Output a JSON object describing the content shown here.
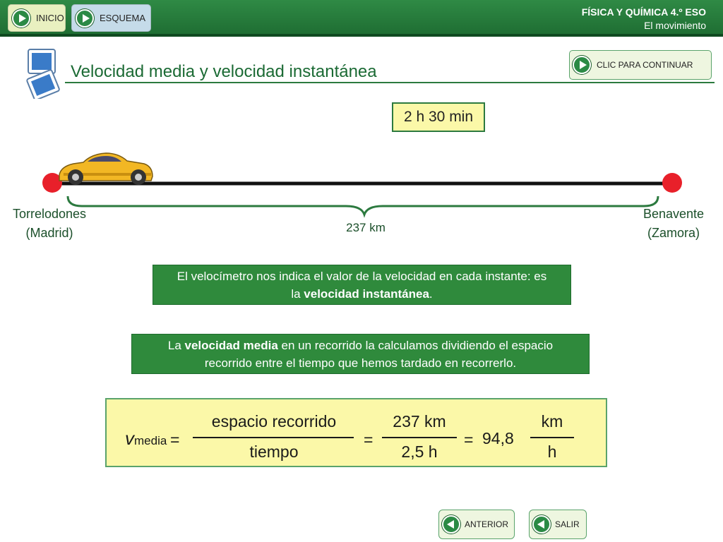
{
  "header": {
    "inicio_label": "INICIO",
    "esquema_label": "ESQUEMA",
    "subject": "FÍSICA Y QUÍMICA 4.º ESO",
    "unit": "El movimiento"
  },
  "title": "Velocidad media y velocidad instantánea",
  "continue_label": "CLIC PARA CONTINUAR",
  "time": "2 h 30 min",
  "route": {
    "origin_line1": "Torrelodones",
    "origin_line2": "(Madrid)",
    "destination_line1": "Benavente",
    "destination_line2": "(Zamora)",
    "distance": "237 km"
  },
  "info1": {
    "text_a": "El velocímetro nos indica el valor de la velocidad en cada instante: es la ",
    "bold": "velocidad instantánea",
    "text_b": "."
  },
  "info2": {
    "text_a": "La ",
    "bold": "velocidad media",
    "text_b": " en un recorrido la calculamos dividiendo el espacio recorrido entre el tiempo que hemos tardado en recorrerlo."
  },
  "formula": {
    "v": "v",
    "sub": "media",
    "eq": "=",
    "num1": "espacio recorrido",
    "den1": "tiempo",
    "num2": "237 km",
    "den2": "2,5 h",
    "result": "94,8",
    "unit_num": "km",
    "unit_den": "h"
  },
  "nav": {
    "anterior_label": "ANTERIOR",
    "salir_label": "SALIR"
  },
  "colors": {
    "header_green": "#2f8a45",
    "box_yellow": "#fbf8a8",
    "info_green": "#2f8a3c",
    "marker_red": "#e8202a"
  }
}
